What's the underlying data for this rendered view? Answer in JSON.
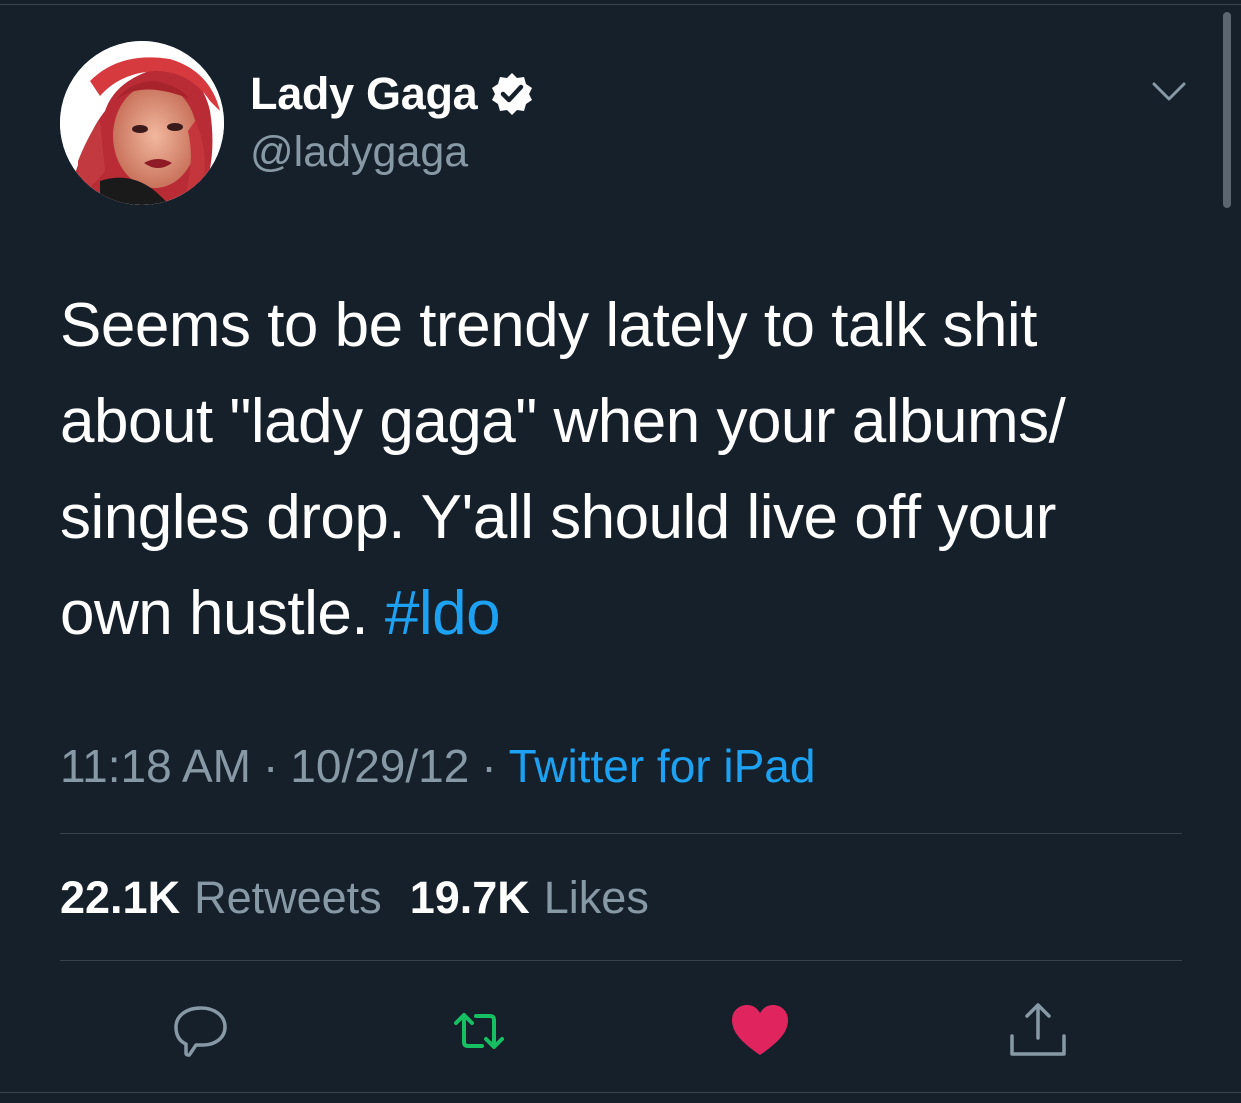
{
  "tweet": {
    "author": {
      "display_name": "Lady Gaga",
      "handle": "@ladygaga",
      "verified": true
    },
    "text_lines": [
      "Seems to be trendy lately to talk shit",
      "about \"lady gaga\" when your albums/",
      "singles drop. Y'all should live off your"
    ],
    "text_last_line": "own hustle. ",
    "hashtag": "#ldo",
    "time": "11:18 AM",
    "date": "10/29/12",
    "separator": "·",
    "source": "Twitter for iPad",
    "stats": {
      "retweets_count": "22.1K",
      "retweets_label": "Retweets",
      "likes_count": "19.7K",
      "likes_label": "Likes"
    }
  },
  "icons": {
    "verified": "verified-badge-icon",
    "more": "chevron-down-icon",
    "reply": "reply-icon",
    "retweet": "retweet-icon",
    "like": "heart-icon",
    "share": "share-icon"
  },
  "colors": {
    "background": "#15202b",
    "text": "#ffffff",
    "secondary_text": "#8899a6",
    "link": "#1da1f2",
    "retweet_active": "#17bf63",
    "like_active": "#e0245e",
    "divider": "#38444d"
  }
}
